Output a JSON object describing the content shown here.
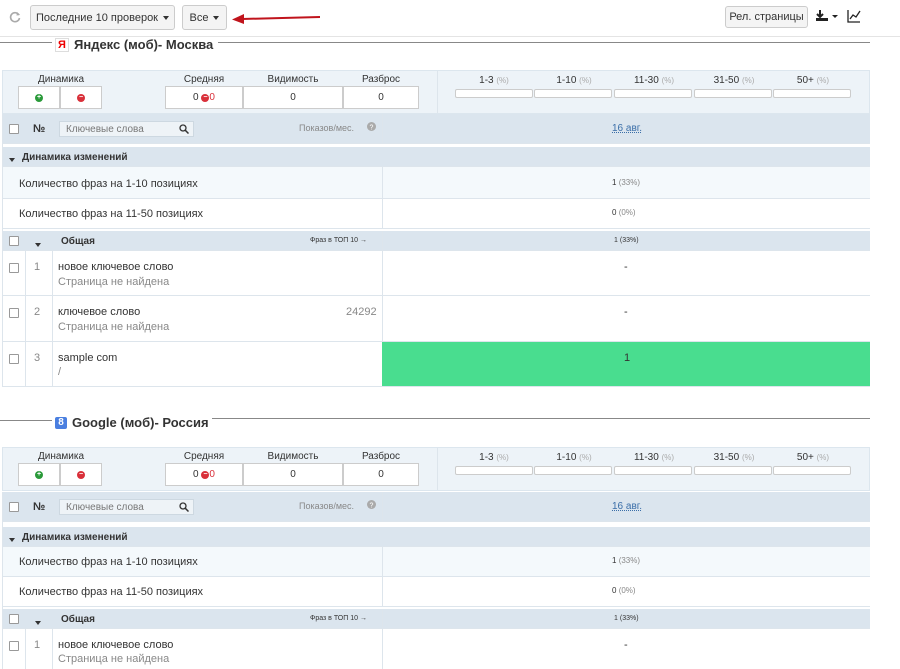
{
  "toolbar": {
    "last_checks_label": "Последние 10 проверок",
    "all_label": "Все",
    "rel_pages_label": "Рел. страницы"
  },
  "sections": [
    {
      "title": "Яндекс (моб)- Москва",
      "logo_char": "Я",
      "labels": {
        "dynamics": "Динамика",
        "average": "Средняя",
        "visibility": "Видимость",
        "spread": "Разброс"
      },
      "average_value": "0",
      "average_delta": "0",
      "visibility_value": "0",
      "spread_value": "0",
      "ranges": [
        "1-3",
        "1-10",
        "11-30",
        "31-50",
        "50+"
      ],
      "range_pct": "(%)",
      "table_header": {
        "no": "№",
        "search_placeholder": "Ключевые слова",
        "impressions": "Показов/мес.",
        "date": "16 авг."
      },
      "dyn_group": "Динамика изменений",
      "stats": [
        {
          "label": "Количество фраз на 1-10 позициях",
          "value": "1",
          "pct": "(33%)"
        },
        {
          "label": "Количество фраз на 11-50 позициях",
          "value": "0",
          "pct": "(0%)"
        }
      ],
      "general": {
        "label": "Общая",
        "top_label": "Фраз в ТОП 10 →",
        "value": "1",
        "pct": "(33%)"
      },
      "keywords": [
        {
          "num": "1",
          "phrase": "новое ключевое слово",
          "page": "Страница не найдена",
          "impressions": "",
          "pos": "-"
        },
        {
          "num": "2",
          "phrase": "ключевое слово",
          "page": "Страница не найдена",
          "impressions": "24292",
          "pos": "-"
        },
        {
          "num": "3",
          "phrase": "sample com",
          "page": "/",
          "impressions": "",
          "pos": "1"
        }
      ]
    },
    {
      "title": "Google (моб)- Россия",
      "logo_char": "8",
      "labels": {
        "dynamics": "Динамика",
        "average": "Средняя",
        "visibility": "Видимость",
        "spread": "Разброс"
      },
      "average_value": "0",
      "average_delta": "0",
      "visibility_value": "0",
      "spread_value": "0",
      "ranges": [
        "1-3",
        "1-10",
        "11-30",
        "31-50",
        "50+"
      ],
      "range_pct": "(%)",
      "table_header": {
        "no": "№",
        "search_placeholder": "Ключевые слова",
        "impressions": "Показов/мес.",
        "date": "16 авг."
      },
      "dyn_group": "Динамика изменений",
      "stats": [
        {
          "label": "Количество фраз на 1-10 позициях",
          "value": "1",
          "pct": "(33%)"
        },
        {
          "label": "Количество фраз на 11-50 позициях",
          "value": "0",
          "pct": "(0%)"
        }
      ],
      "general": {
        "label": "Общая",
        "top_label": "Фраз в ТОП 10 →",
        "value": "1",
        "pct": "(33%)"
      },
      "keywords": [
        {
          "num": "1",
          "phrase": "новое ключевое слово",
          "page": "Страница не найдена",
          "impressions": "",
          "pos": "-"
        }
      ]
    }
  ],
  "colors": {
    "accent_green": "#49dd8f",
    "annotation_arrow": "#c0141c",
    "header_bg": "#dbe5ee"
  }
}
